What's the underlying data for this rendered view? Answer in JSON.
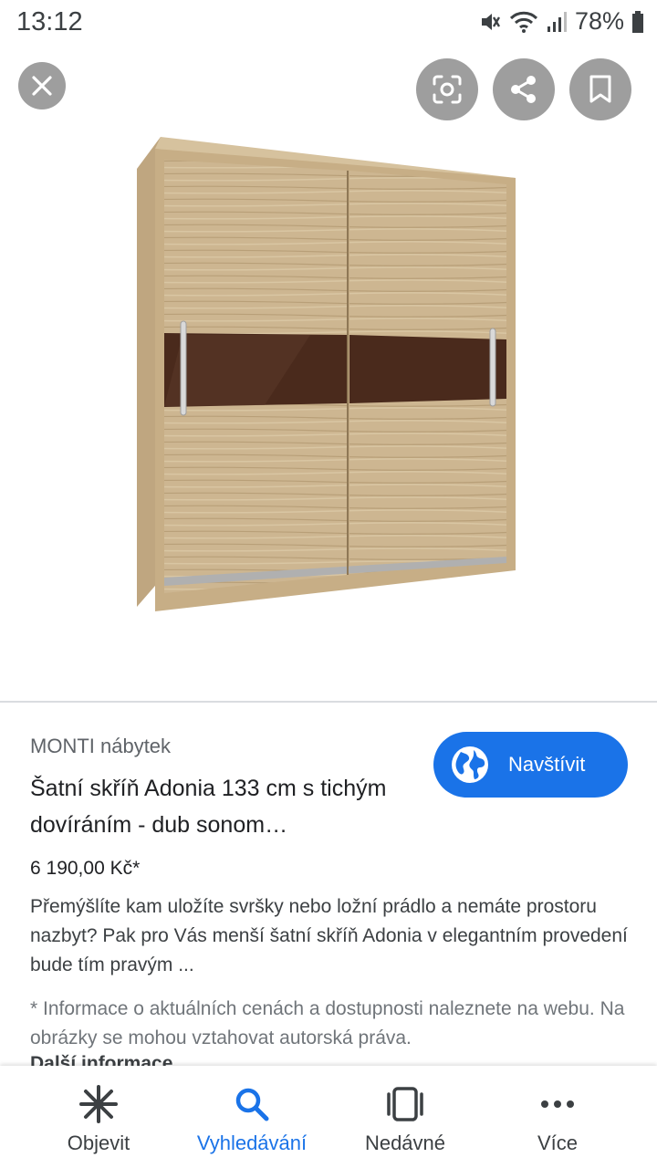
{
  "status": {
    "time": "13:12",
    "battery": "78%"
  },
  "viewer": {
    "close_icon": "close-icon",
    "lens_icon": "lens-icon",
    "share_icon": "share-icon",
    "bookmark_icon": "bookmark-icon"
  },
  "result": {
    "site": "MONTI nábytek",
    "title": "Šatní skříň Adonia 133 cm s tichým dovíráním - dub sonom…",
    "visit_label": "Navštívit",
    "price": "6 190,00 Kč*",
    "description": "Přemýšlíte kam uložíte svršky nebo ložní prádlo a nemáte prostoru nazbyt? Pak pro Vás menší šatní skříň Adonia v elegantním provedení bude tím pravým ...",
    "notice": "* Informace o aktuálních cenách a dostupnosti naleznete na webu. Na obrázky se mohou vztahovat autorská práva.",
    "more_info": "Další informace"
  },
  "nav": {
    "items": [
      {
        "label": "Objevit",
        "icon": "asterisk-icon",
        "active": false
      },
      {
        "label": "Vyhledávání",
        "icon": "search-icon",
        "active": true
      },
      {
        "label": "Nedávné",
        "icon": "tabs-icon",
        "active": false
      },
      {
        "label": "Více",
        "icon": "more-icon",
        "active": false
      }
    ]
  },
  "colors": {
    "accent": "#1a73e8",
    "overlay_button": "#9e9e9e"
  }
}
